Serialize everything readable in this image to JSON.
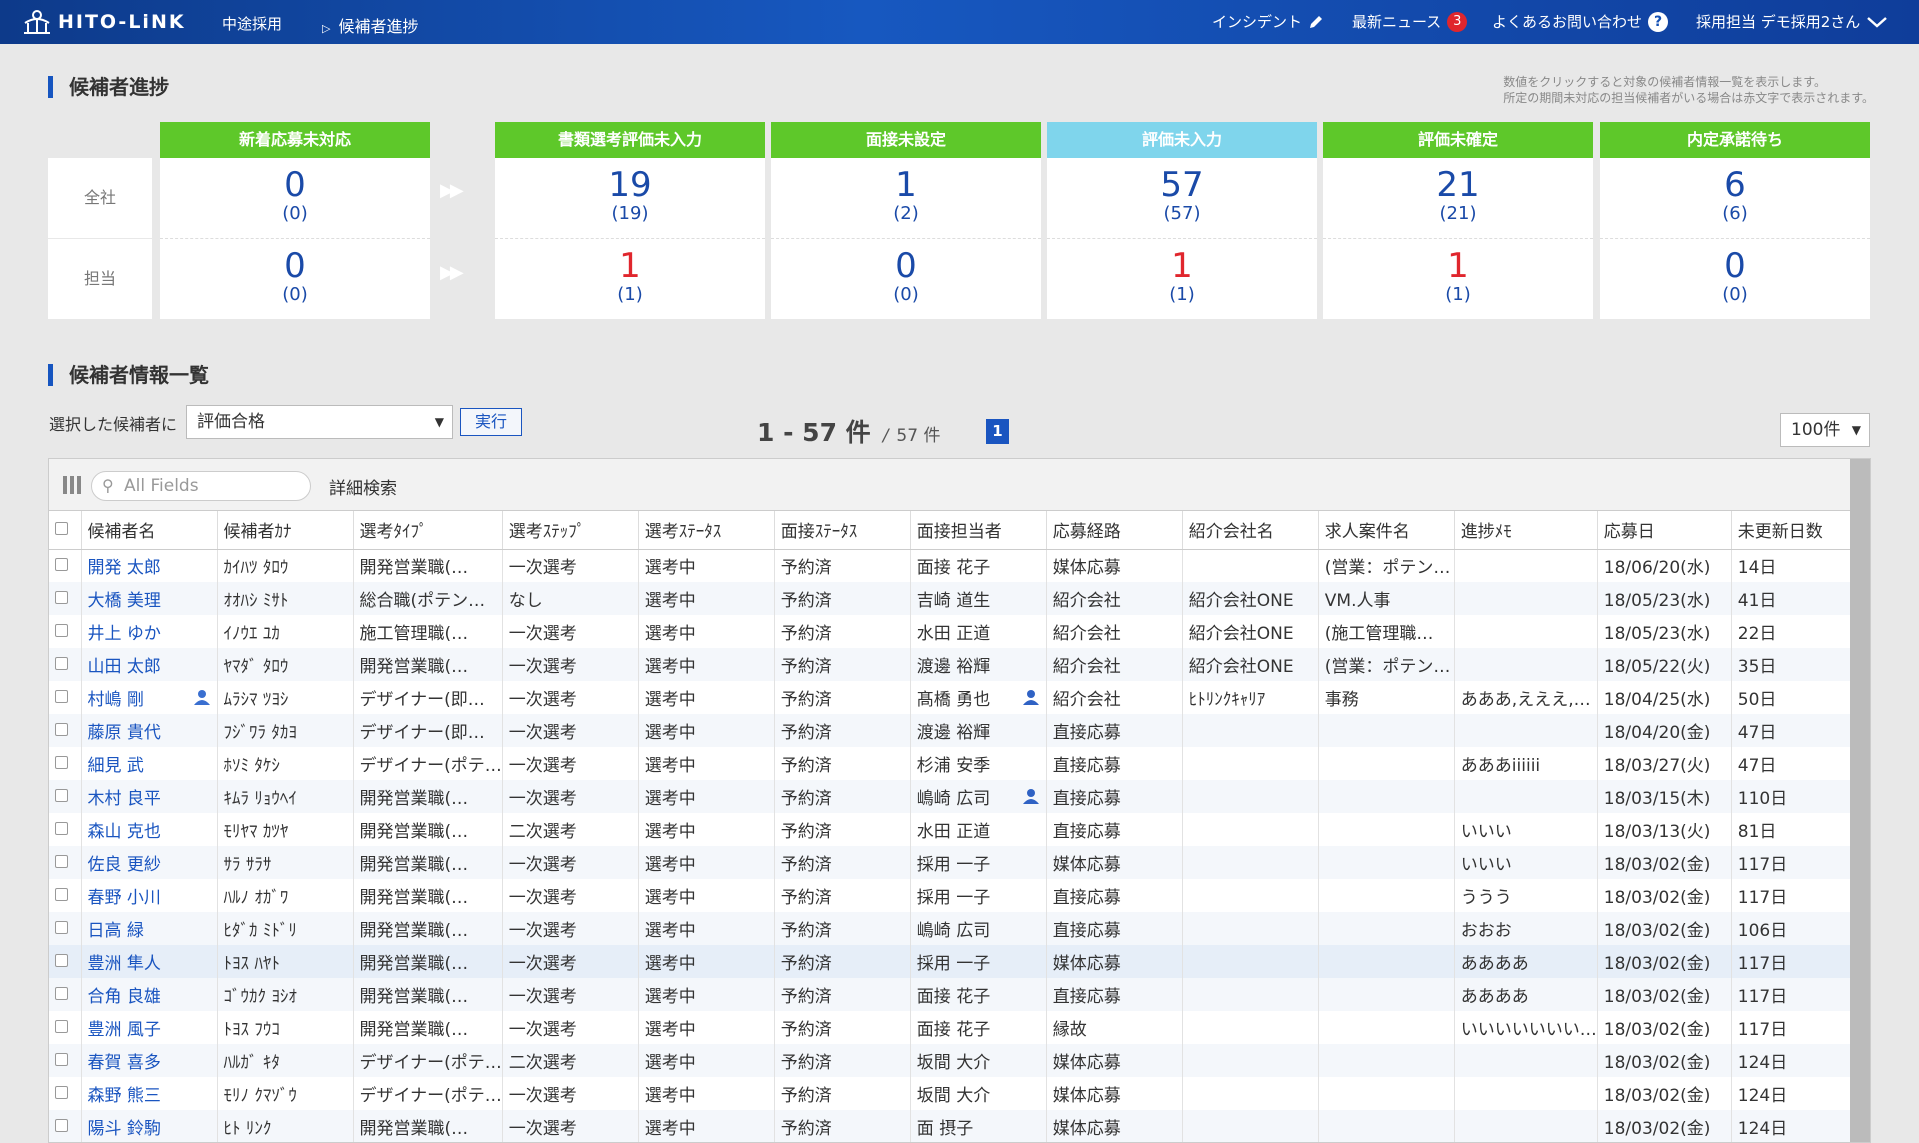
{
  "header": {
    "logo_text": "HITO-LiNK",
    "category": "中途採用",
    "breadcrumb": "候補者進捗",
    "incident_label": "インシデント",
    "news_label": "最新ニュース",
    "news_count": "3",
    "faq_label": "よくあるお問い合わせ",
    "faq_icon_text": "?",
    "user_label": "採用担当 デモ採用2さん"
  },
  "progress": {
    "title": "候補者進捗",
    "note_line1": "数値をクリックすると対象の候補者情報一覧を表示します。",
    "note_line2": "所定の期間未対応の担当候補者がいる場合は赤文字で表示されます。",
    "row_labels": [
      "全社",
      "担当"
    ],
    "columns": [
      {
        "label": "新着応募未対応",
        "all": "0",
        "all_sub": "(0)",
        "mine": "0",
        "mine_sub": "(0)",
        "color": "#5ec82a"
      },
      {
        "label": "書類選考評価未入力",
        "all": "19",
        "all_sub": "(19)",
        "mine": "1",
        "mine_sub": "(1)",
        "color": "#5ec82a"
      },
      {
        "label": "面接未設定",
        "all": "1",
        "all_sub": "(2)",
        "mine": "0",
        "mine_sub": "(0)",
        "color": "#5ec82a"
      },
      {
        "label": "評価未入力",
        "all": "57",
        "all_sub": "(57)",
        "mine": "1",
        "mine_sub": "(1)",
        "color": "#7fd5ec"
      },
      {
        "label": "評価未確定",
        "all": "21",
        "all_sub": "(21)",
        "mine": "1",
        "mine_sub": "(1)",
        "color": "#5ec82a"
      },
      {
        "label": "内定承諾待ち",
        "all": "6",
        "all_sub": "(6)",
        "mine": "0",
        "mine_sub": "(0)",
        "color": "#5ec82a"
      }
    ]
  },
  "list": {
    "title": "候補者情報一覧",
    "action_label": "選択した候補者に",
    "action_value": "評価合格",
    "run_button": "実行",
    "count_main": "1 - 57 件",
    "count_total": "57 件",
    "page": "1",
    "per_page": "100件",
    "search_placeholder": "All Fields",
    "advanced_search": "詳細検索",
    "columns": [
      "候補者名",
      "候補者ｶﾅ",
      "選考ﾀｲﾌﾟ",
      "選考ｽﾃｯﾌﾟ",
      "選考ｽﾃｰﾀｽ",
      "面接ｽﾃｰﾀｽ",
      "面接担当者",
      "応募経路",
      "紹介会社名",
      "求人案件名",
      "進捗ﾒﾓ",
      "応募日",
      "未更新日数"
    ],
    "rows": [
      [
        "開発 太郎",
        "ｶｲﾊﾂ ﾀﾛｳ",
        "開発営業職(…",
        "一次選考",
        "選考中",
        "予約済",
        "面接 花子",
        "媒体応募",
        "",
        "(営業：ポテン…",
        "",
        "18/06/20(水)",
        "14日"
      ],
      [
        "大橋 美理",
        "ｵｵﾊｼ ﾐｻﾄ",
        "総合職(ポテン…",
        "なし",
        "選考中",
        "予約済",
        "吉崎 道生",
        "紹介会社",
        "紹介会社ONE",
        "VM.人事",
        "",
        "18/05/23(水)",
        "41日"
      ],
      [
        "井上 ゆか",
        "ｲﾉｳｴ ﾕｶ",
        "施工管理職(…",
        "一次選考",
        "選考中",
        "予約済",
        "水田 正道",
        "紹介会社",
        "紹介会社ONE",
        "(施工管理職…",
        "",
        "18/05/23(水)",
        "22日"
      ],
      [
        "山田 太郎",
        "ﾔﾏﾀﾞ ﾀﾛｳ",
        "開発営業職(…",
        "一次選考",
        "選考中",
        "予約済",
        "渡邊 裕輝",
        "紹介会社",
        "紹介会社ONE",
        "(営業：ポテン…",
        "",
        "18/05/22(火)",
        "35日"
      ],
      [
        "村嶋 剛",
        "ﾑﾗｼﾏ ﾂﾖｼ",
        "デザイナー(即…",
        "一次選考",
        "選考中",
        "予約済",
        "髙橋 勇也",
        "紹介会社",
        "ﾋﾄﾘﾝｸｷｬﾘｱ",
        "事務",
        "あああ,えええ,…",
        "18/04/25(水)",
        "50日"
      ],
      [
        "藤原 貴代",
        "ﾌｼﾞﾜﾗ ﾀｶﾖ",
        "デザイナー(即…",
        "一次選考",
        "選考中",
        "予約済",
        "渡邊 裕輝",
        "直接応募",
        "",
        "",
        "",
        "18/04/20(金)",
        "47日"
      ],
      [
        "細見 武",
        "ﾎｿﾐ ﾀｹｼ",
        "デザイナー(ポテ…",
        "一次選考",
        "選考中",
        "予約済",
        "杉浦 安季",
        "直接応募",
        "",
        "",
        "あああiiiiii",
        "18/03/27(火)",
        "47日"
      ],
      [
        "木村 良平",
        "ｷﾑﾗ ﾘｮｳﾍｲ",
        "開発営業職(…",
        "一次選考",
        "選考中",
        "予約済",
        "嶋崎 広司",
        "直接応募",
        "",
        "",
        "",
        "18/03/15(木)",
        "110日"
      ],
      [
        "森山 克也",
        "ﾓﾘﾔﾏ ｶﾂﾔ",
        "開発営業職(…",
        "二次選考",
        "選考中",
        "予約済",
        "水田 正道",
        "直接応募",
        "",
        "",
        "いいい",
        "18/03/13(火)",
        "81日"
      ],
      [
        "佐良 更紗",
        "ｻﾗ ｻﾗｻ",
        "開発営業職(…",
        "一次選考",
        "選考中",
        "予約済",
        "採用 一子",
        "媒体応募",
        "",
        "",
        "いいい",
        "18/03/02(金)",
        "117日"
      ],
      [
        "春野 小川",
        "ﾊﾙﾉ ｵｶﾞﾜ",
        "開発営業職(…",
        "一次選考",
        "選考中",
        "予約済",
        "採用 一子",
        "直接応募",
        "",
        "",
        "ううう",
        "18/03/02(金)",
        "117日"
      ],
      [
        "日高 緑",
        "ﾋﾀﾞｶ ﾐﾄﾞﾘ",
        "開発営業職(…",
        "一次選考",
        "選考中",
        "予約済",
        "嶋崎 広司",
        "直接応募",
        "",
        "",
        "おおお",
        "18/03/02(金)",
        "106日"
      ],
      [
        "豊洲 隼人",
        "ﾄﾖｽ ﾊﾔﾄ",
        "開発営業職(…",
        "一次選考",
        "選考中",
        "予約済",
        "採用 一子",
        "媒体応募",
        "",
        "",
        "ああああ",
        "18/03/02(金)",
        "117日"
      ],
      [
        "合角 良雄",
        "ｺﾞｳｶｸ ﾖｼｵ",
        "開発営業職(…",
        "一次選考",
        "選考中",
        "予約済",
        "面接 花子",
        "直接応募",
        "",
        "",
        "ああああ",
        "18/03/02(金)",
        "117日"
      ],
      [
        "豊洲 風子",
        "ﾄﾖｽ ﾌｳｺ",
        "開発営業職(…",
        "一次選考",
        "選考中",
        "予約済",
        "面接 花子",
        "縁故",
        "",
        "",
        "いいいいいいい…",
        "18/03/02(金)",
        "117日"
      ],
      [
        "春賀 喜多",
        "ﾊﾙｶﾞ ｷﾀ",
        "デザイナー(ポテ…",
        "二次選考",
        "選考中",
        "予約済",
        "坂間 大介",
        "媒体応募",
        "",
        "",
        "",
        "18/03/02(金)",
        "124日"
      ],
      [
        "森野 熊三",
        "ﾓﾘﾉ ｸﾏｿﾞｳ",
        "デザイナー(ポテ…",
        "一次選考",
        "選考中",
        "予約済",
        "坂間 大介",
        "媒体応募",
        "",
        "",
        "",
        "18/03/02(金)",
        "124日"
      ],
      [
        "陽斗 鈴駒",
        "ﾋﾄ ﾘﾝｸ",
        "開発営業職(…",
        "一次選考",
        "選考中",
        "予約済",
        "面 摂子",
        "媒体応募",
        "",
        "",
        "",
        "18/03/02(金)",
        "124日"
      ]
    ]
  }
}
